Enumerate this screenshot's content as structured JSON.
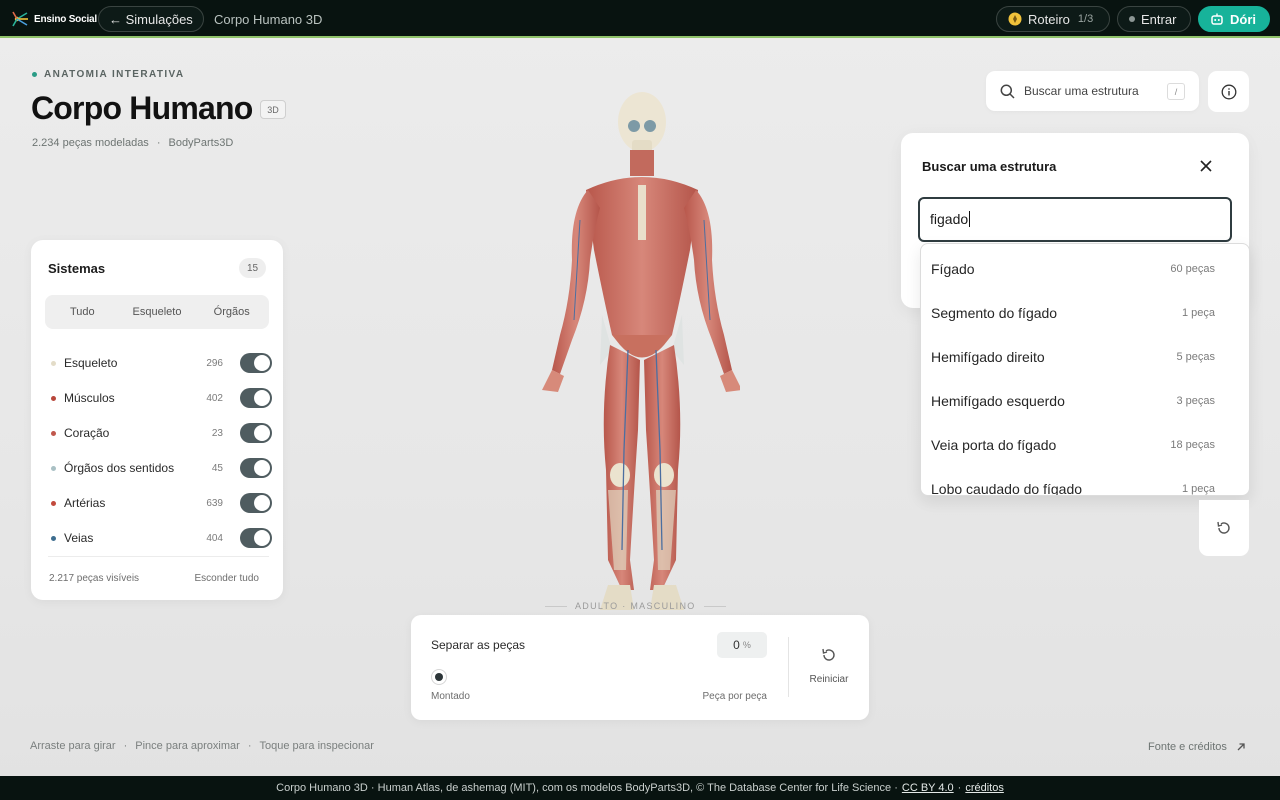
{
  "topbar": {
    "brand": "Ensino Social",
    "back_label": "← Simulações",
    "title": "Corpo Humano 3D",
    "roteiro_label": "Roteiro",
    "roteiro_count": "1/3",
    "entrar_label": "Entrar",
    "dori_label": "Dóri",
    "accent": "#17b39a"
  },
  "header": {
    "eyebrow": "ANATOMIA INTERATIVA",
    "title": "Corpo Humano",
    "badge": "3D",
    "pieces": "2.234 peças modeladas",
    "source": "BodyParts3D"
  },
  "systems": {
    "title": "Sistemas",
    "count": "15",
    "tabs": [
      "Tudo",
      "Esqueleto",
      "Órgãos"
    ],
    "items": [
      {
        "name": "Esqueleto",
        "count": "296",
        "color": "#e3dcc8",
        "on": true
      },
      {
        "name": "Músculos",
        "count": "402",
        "color": "#b8473b",
        "on": true
      },
      {
        "name": "Coração",
        "count": "23",
        "color": "#c0574c",
        "on": true
      },
      {
        "name": "Órgãos dos sentidos",
        "count": "45",
        "color": "#a9c0c4",
        "on": true
      },
      {
        "name": "Artérias",
        "count": "639",
        "color": "#c24a3d",
        "on": true
      },
      {
        "name": "Veias",
        "count": "404",
        "color": "#3e6d8f",
        "on": true
      }
    ],
    "visible": "2.217 peças visíveis",
    "hide_all": "Esconder tudo"
  },
  "figure": {
    "platform_label": "ADULTO · MASCULINO"
  },
  "search": {
    "placeholder": "Buscar uma estrutura",
    "shortcut": "/",
    "modal_title": "Buscar uma estrutura",
    "query": "figado",
    "results": [
      {
        "name": "Fígado",
        "count": "60 peças"
      },
      {
        "name": "Segmento do fígado",
        "count": "1 peça"
      },
      {
        "name": "Hemifígado direito",
        "count": "5 peças"
      },
      {
        "name": "Hemifígado esquerdo",
        "count": "3 peças"
      },
      {
        "name": "Veia porta do fígado",
        "count": "18 peças"
      },
      {
        "name": "Lobo caudado do fígado",
        "count": "1 peça"
      }
    ]
  },
  "explode": {
    "label": "Separar as peças",
    "value": "0",
    "unit": "%",
    "min_label": "Montado",
    "max_label": "Peça por peça",
    "reset_label": "Reiniciar"
  },
  "hints": [
    "Arraste para girar",
    "Pince para aproximar",
    "Toque para inspecionar"
  ],
  "credits_label": "Fonte e créditos",
  "footer": {
    "text": "Corpo Humano 3D · Human Atlas, de ashemag (MIT), com os modelos BodyParts3D, © The Database Center for Life Science ·",
    "license": "CC BY 4.0",
    "dot": "·",
    "credits": "créditos"
  }
}
